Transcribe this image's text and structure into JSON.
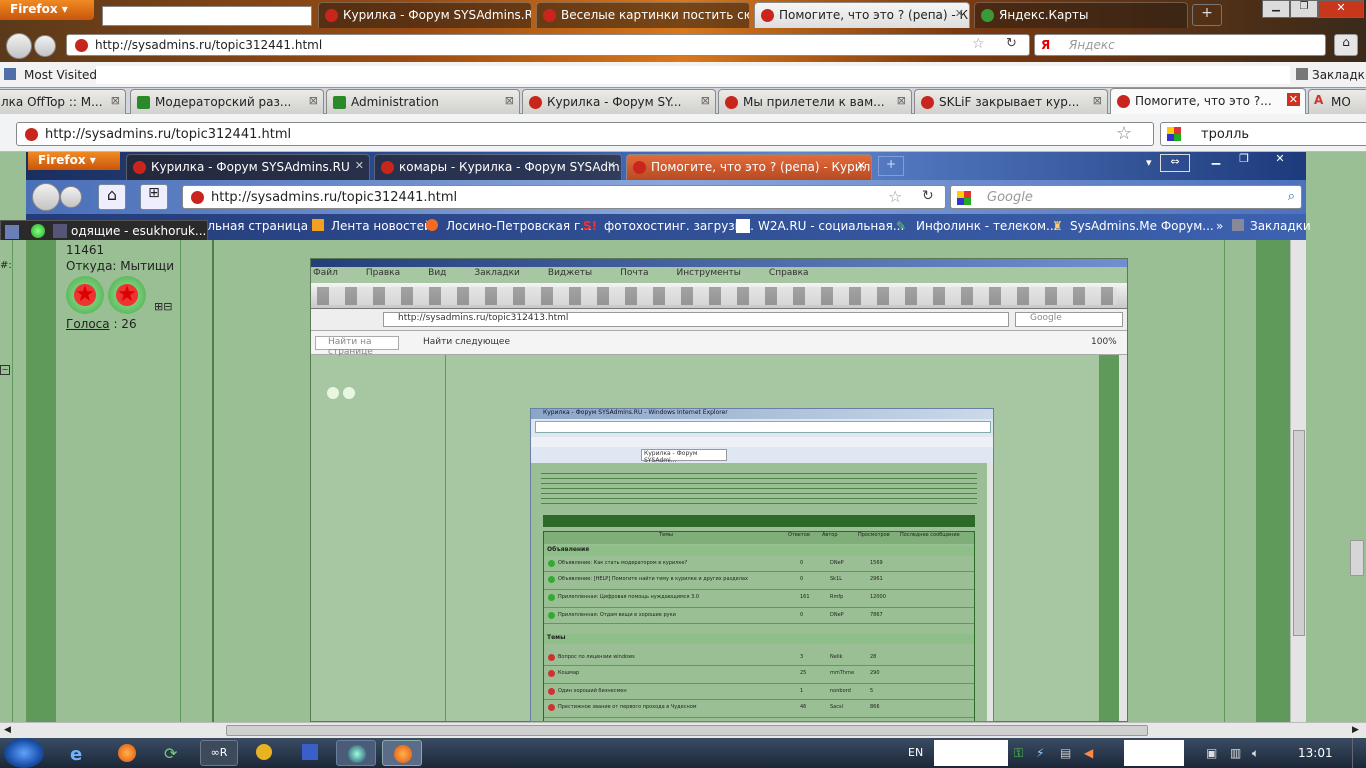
{
  "outer": {
    "firefox_label": "Firefox",
    "tabs": [
      {
        "label": "Курилка - Форум SYSAdmins.RU"
      },
      {
        "label": "Веселые картинки постить сю..."
      },
      {
        "label": "Помогите, что это ? (репа) - К..."
      },
      {
        "label": "Яндекс.Карты"
      }
    ],
    "url": "http://sysadmins.ru/topic312441.html",
    "search_placeholder": "Яндекс",
    "most_visited": "Most Visited",
    "bookmarks_label": "Закладки"
  },
  "inner1": {
    "tabs": [
      {
        "label": "лка OffTop :: М..."
      },
      {
        "label": "Модераторский раз..."
      },
      {
        "label": "Administration"
      },
      {
        "label": "Курилка - Форум SY..."
      },
      {
        "label": "Мы прилетели к вам..."
      },
      {
        "label": "SKLiF закрывает кур..."
      },
      {
        "label": "Помогите, что это ?..."
      },
      {
        "label": "МО"
      }
    ],
    "url": "http://sysadmins.ru/topic312441.html",
    "search_value": "тролль"
  },
  "inner2": {
    "firefox_label": "Firefox",
    "tabs": [
      {
        "label": "Курилка - Форум SYSAdmins.RU"
      },
      {
        "label": "комары - Курилка - Форум SYSAdm..."
      },
      {
        "label": "Помогите, что это ? (репа) - Курилк..."
      }
    ],
    "url": "http://sysadmins.ru/topic312441.html",
    "search_placeholder": "Google",
    "bookmarks": [
      {
        "label": "альная страница"
      },
      {
        "label": "Лента новостей"
      },
      {
        "label": "Лосино-Петровская г..."
      },
      {
        "label": "фотохостинг. загрузи..."
      },
      {
        "label": "W2A.RU - социальная..."
      },
      {
        "label": "Инфолинк - телеком..."
      },
      {
        "label": "SysAdmins.Me Форум..."
      }
    ],
    "bookmarks_label": "Закладки"
  },
  "popup_tab": "одящие - esukhoruk...",
  "profile": {
    "number": "11461",
    "from_label": "Откуда: Мытищи",
    "votes_label": "Голоса",
    "votes_value": ": 26"
  },
  "opera": {
    "menu": [
      "Файл",
      "Правка",
      "Вид",
      "Закладки",
      "Виджеты",
      "Почта",
      "Инструменты",
      "Справка"
    ],
    "url": "http://sysadmins.ru/topic312413.html",
    "search": "Google",
    "find_label": "Найти на странице",
    "find_value": "Найти следующее",
    "zoom": "100%"
  },
  "ie": {
    "title": "Курилка - Форум SYSAdmins.RU - Windows Internet Explorer",
    "tab": "Курилка - Форум SYSAdmi...",
    "section_forum": "Объявления",
    "section_topics": "Темы",
    "headers": [
      "Темы",
      "Ответов",
      "Автор",
      "Просмотров",
      "Последнее сообщение"
    ],
    "rows": [
      {
        "title": "Объявление: Как стать модератором в курилке?",
        "replies": "0",
        "author": "DNeP",
        "views": "1569"
      },
      {
        "title": "Объявление: [HELP] Помогите найти тему в курилке и других разделах",
        "replies": "0",
        "author": "Sk1L",
        "views": "2961"
      },
      {
        "title": "Прилепленная: Цифровая помощь нуждающимся 3.0",
        "replies": "161",
        "author": "Rmfp",
        "views": "12000"
      },
      {
        "title": "Прилепленная: Отдам вещи в хорошие руки",
        "replies": "0",
        "author": "DNeP",
        "views": "7867"
      },
      {
        "title": "Вопрос по лицензии windows",
        "replies": "3",
        "author": "Nelik",
        "views": "28"
      },
      {
        "title": "Кошмар",
        "replies": "25",
        "author": "mmThrne",
        "views": "290"
      },
      {
        "title": "Один хороший бизнесмен",
        "replies": "1",
        "author": "nonbord",
        "views": "5"
      },
      {
        "title": "Престижное звание от первого прохода в Чудесном",
        "replies": "46",
        "author": "Sacsl",
        "views": "866"
      }
    ]
  },
  "taskbar": {
    "lang": "EN",
    "time": "13:01"
  }
}
